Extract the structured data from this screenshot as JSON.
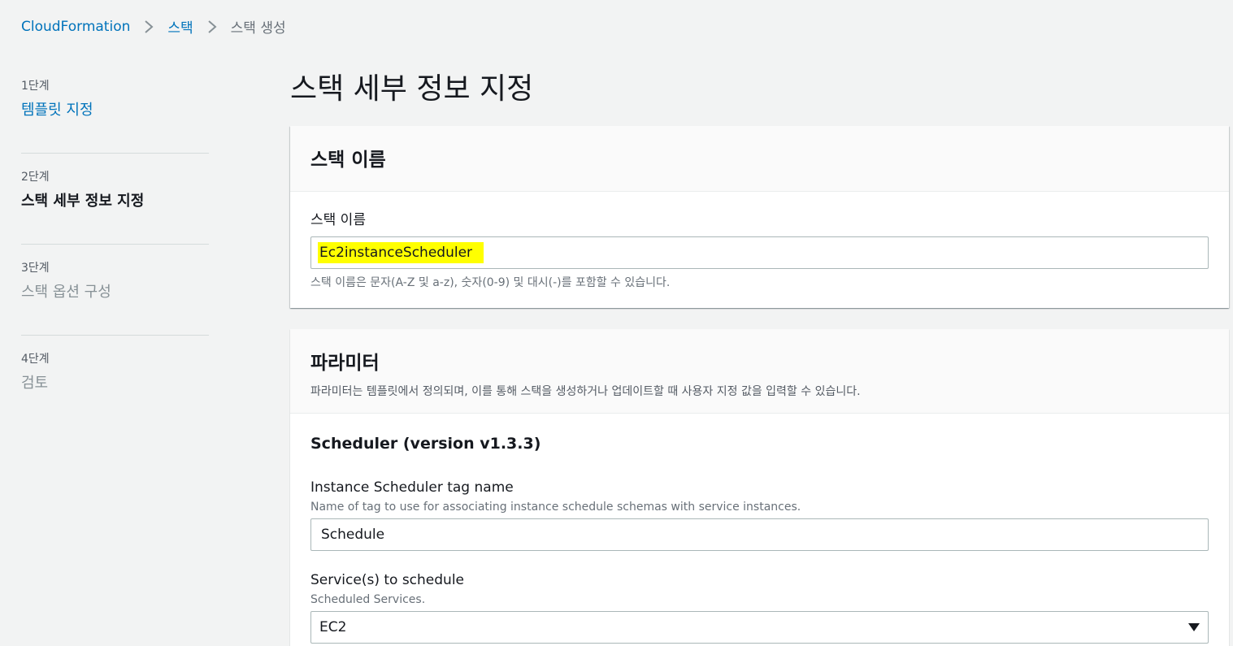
{
  "breadcrumb": {
    "items": [
      "CloudFormation",
      "스택",
      "스택 생성"
    ]
  },
  "steps": [
    {
      "num": "1단계",
      "title": "템플릿 지정",
      "state": "link"
    },
    {
      "num": "2단계",
      "title": "스택 세부 정보 지정",
      "state": "active"
    },
    {
      "num": "3단계",
      "title": "스택 옵션 구성",
      "state": "disabled"
    },
    {
      "num": "4단계",
      "title": "검토",
      "state": "disabled"
    }
  ],
  "page": {
    "title": "스택 세부 정보 지정"
  },
  "stack_name": {
    "header": "스택 이름",
    "label": "스택 이름",
    "value": "Ec2instanceScheduler",
    "hint": "스택 이름은 문자(A-Z 및 a-z), 숫자(0-9) 및 대시(-)를 포함할 수 있습니다."
  },
  "parameters": {
    "header": "파라미터",
    "description": "파라미터는 템플릿에서 정의되며, 이를 통해 스택을 생성하거나 업데이트할 때 사용자 지정 값을 입력할 수 있습니다.",
    "section_title": "Scheduler (version v1.3.3)",
    "tag_name": {
      "label": "Instance Scheduler tag name",
      "description": "Name of tag to use for associating instance schedule schemas with service instances.",
      "value": "Schedule"
    },
    "services": {
      "label": "Service(s) to schedule",
      "description": "Scheduled Services.",
      "value": "EC2"
    }
  },
  "colors": {
    "link": "#0073bb",
    "highlight": "#ffff00",
    "background": "#f2f3f3"
  },
  "icons": {
    "breadcrumb_separator": "chevron-right-icon",
    "select_caret": "caret-down-icon"
  }
}
